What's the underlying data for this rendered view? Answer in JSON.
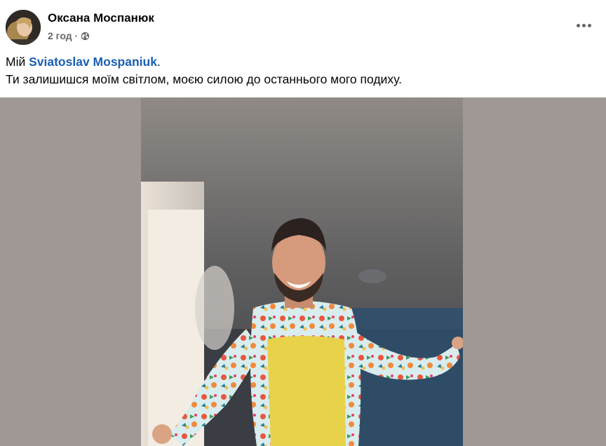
{
  "post": {
    "author": "Оксана Моспанюк",
    "time": "2 год",
    "separator": "·",
    "privacy_icon": "globe-icon",
    "more_icon": "more-options-icon",
    "caption": {
      "prefix": "Мій ",
      "mention": "Sviatoslav Mospaniuk",
      "suffix": ".",
      "line2": "Ти залишишся моїм світлом, моєю силою до останнього мого подиху."
    }
  },
  "colors": {
    "mention": "#1a5fb4",
    "meta_text": "#65676b",
    "media_background": "#9f9894"
  }
}
